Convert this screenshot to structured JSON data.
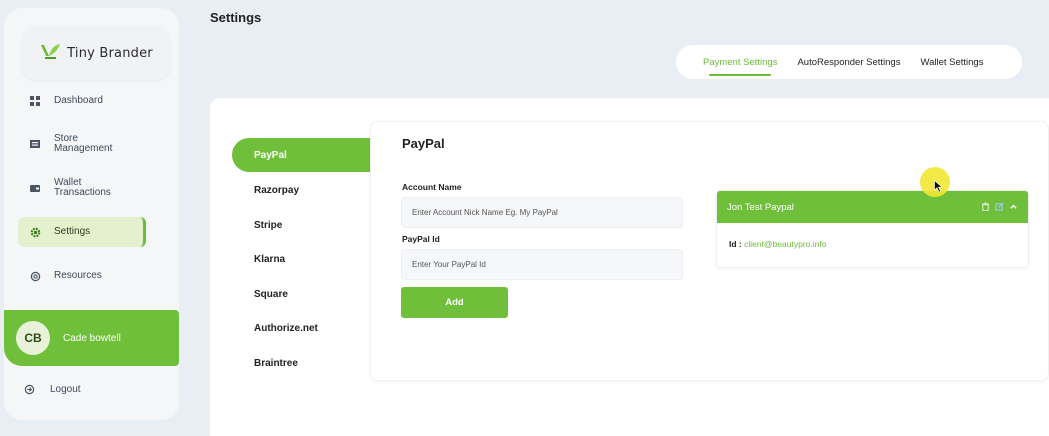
{
  "app": {
    "brand_name": "Tiny Brander"
  },
  "sidebar": {
    "items": [
      {
        "label": "Dashboard",
        "icon": "dashboard-icon"
      },
      {
        "label": "Store Management",
        "icon": "store-icon"
      },
      {
        "label": "Wallet Transactions",
        "icon": "wallet-icon"
      },
      {
        "label": "Settings",
        "icon": "gear-icon",
        "active": true
      },
      {
        "label": "Resources",
        "icon": "resources-icon"
      }
    ],
    "user": {
      "initials": "CB",
      "name": "Cade bowtell"
    },
    "logout_label": "Logout"
  },
  "header": {
    "title": "Settings",
    "tabs": [
      {
        "label": "Payment Settings",
        "active": true
      },
      {
        "label": "AutoResponder Settings"
      },
      {
        "label": "Wallet Settings"
      }
    ]
  },
  "providers": [
    {
      "label": "PayPal",
      "active": true
    },
    {
      "label": "Razorpay"
    },
    {
      "label": "Stripe"
    },
    {
      "label": "Klarna"
    },
    {
      "label": "Square"
    },
    {
      "label": "Authorize.net"
    },
    {
      "label": "Braintree"
    }
  ],
  "form": {
    "title": "PayPal",
    "account_name_label": "Account Name",
    "account_name_placeholder": "Enter Account Nick Name Eg. My PayPal",
    "paypal_id_label": "PayPal Id",
    "paypal_id_placeholder": "Enter Your PayPal Id",
    "add_label": "Add"
  },
  "account": {
    "name": "Jon Test Paypal",
    "id_label": "Id :",
    "id_value": "client@beautypro.info"
  },
  "colors": {
    "accent": "#70bf3b",
    "active_bg": "#e3f1cf",
    "background": "#e9eef5"
  }
}
